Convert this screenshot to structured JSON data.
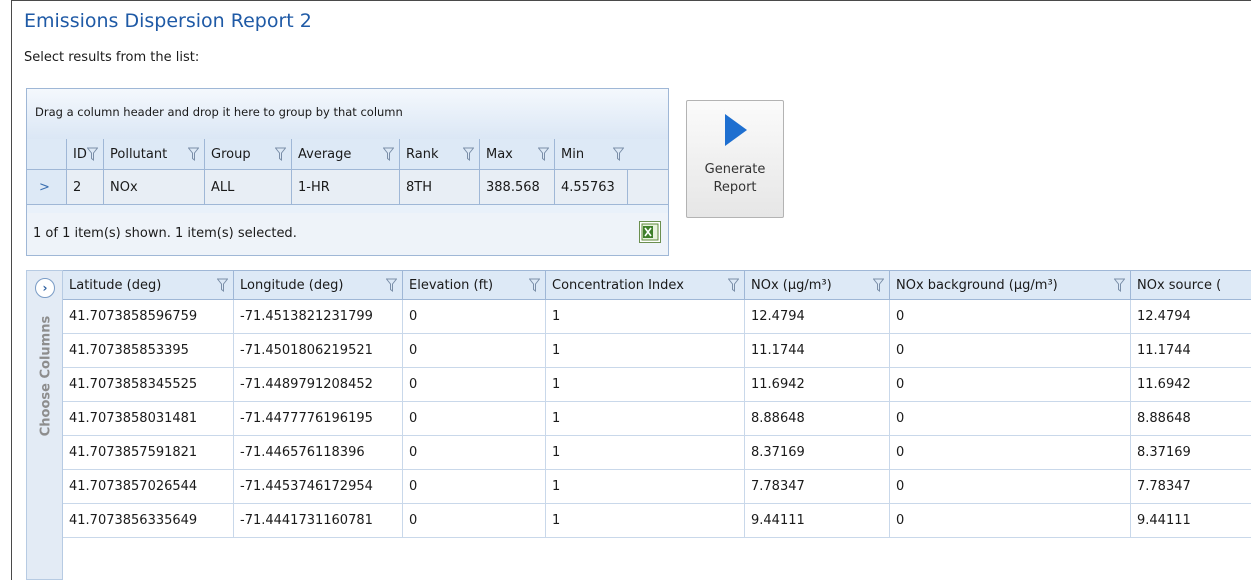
{
  "title": "Emissions Dispersion Report 2",
  "subtitle": "Select results from the list:",
  "results_grid": {
    "group_hint": "Drag a column header and drop it here to group by that column",
    "columns": [
      "ID",
      "Pollutant",
      "Group",
      "Average",
      "Rank",
      "Max",
      "Min"
    ],
    "rows": [
      [
        "2",
        "NOx",
        "ALL",
        "1-HR",
        "8TH",
        "388.568",
        "4.55763"
      ]
    ],
    "row_indicator": ">",
    "status": "1 of 1 item(s) shown. 1 item(s) selected.",
    "export_icon": "excel-export-icon"
  },
  "generate_button": {
    "line1": "Generate",
    "line2": "Report",
    "icon": "play-arrow-icon",
    "icon_color": "#1e6fd0"
  },
  "column_chooser": {
    "label": "Choose Columns",
    "icon": "chevron-right-circle-icon"
  },
  "data_grid": {
    "columns": [
      "Latitude (deg)",
      "Longitude (deg)",
      "Elevation (ft)",
      "Concentration Index",
      "NOx (μg/m³)",
      "NOx background (μg/m³)",
      "NOx source ("
    ],
    "rows": [
      [
        "41.7073858596759",
        "-71.4513821231799",
        "0",
        "1",
        "12.4794",
        "0",
        "12.4794"
      ],
      [
        "41.707385853395",
        "-71.4501806219521",
        "0",
        "1",
        "11.1744",
        "0",
        "11.1744"
      ],
      [
        "41.7073858345525",
        "-71.4489791208452",
        "0",
        "1",
        "11.6942",
        "0",
        "11.6942"
      ],
      [
        "41.7073858031481",
        "-71.4477776196195",
        "0",
        "1",
        "8.88648",
        "0",
        "8.88648"
      ],
      [
        "41.7073857591821",
        "-71.446576118396",
        "0",
        "1",
        "8.37169",
        "0",
        "8.37169"
      ],
      [
        "41.7073857026544",
        "-71.4453746172954",
        "0",
        "1",
        "7.78347",
        "0",
        "7.78347"
      ],
      [
        "41.7073856335649",
        "-71.4441731160781",
        "0",
        "1",
        "9.44111",
        "0",
        "9.44111"
      ]
    ]
  },
  "colors": {
    "title": "#1f5aa6",
    "header_bg": "#dde9f6",
    "grid_border": "#9fb7d6"
  }
}
